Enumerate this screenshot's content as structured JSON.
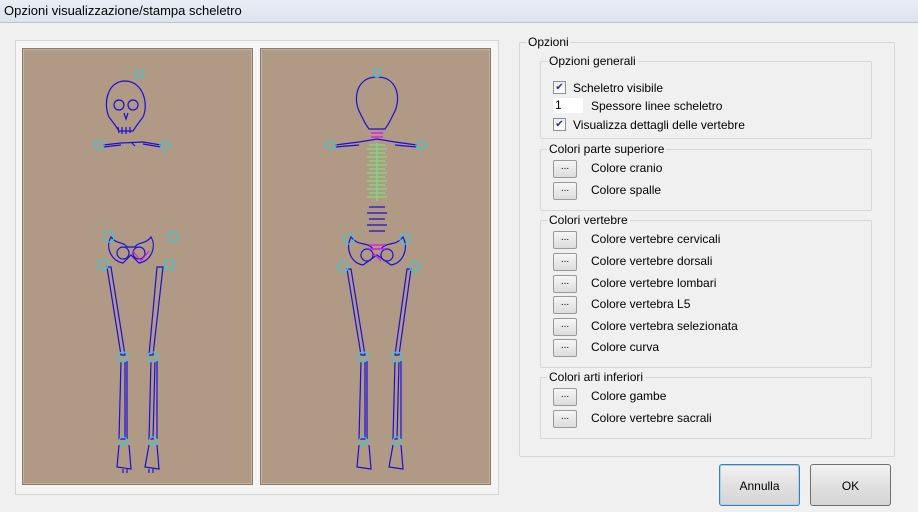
{
  "window": {
    "title": "Opzioni visualizzazione/stampa scheletro"
  },
  "options": {
    "title": "Opzioni",
    "general": {
      "title": "Opzioni generali",
      "skeleton_visible": {
        "label": "Scheletro visibile",
        "checked": true
      },
      "line_thickness": {
        "value": "1",
        "label": "Spessore linee scheletro"
      },
      "vertebra_details": {
        "label": "Visualizza dettagli delle vertebre",
        "checked": true
      }
    },
    "upper": {
      "title": "Colori parte superiore",
      "items": [
        "Colore cranio",
        "Colore spalle"
      ]
    },
    "vertebrae": {
      "title": "Colori vertebre",
      "items": [
        "Colore vertebre cervicali",
        "Colore vertebre dorsali",
        "Colore vertebre lombari",
        "Colore vertebra L5",
        "Colore vertebra selezionata",
        "Colore curva"
      ]
    },
    "lower": {
      "title": "Colori arti inferiori",
      "items": [
        "Colore gambe",
        "Colore vertebre sacrali"
      ]
    },
    "color_button_label": "..."
  },
  "buttons": {
    "cancel": "Annulla",
    "ok": "OK"
  },
  "colors": {
    "pane_background": "#b09a86",
    "bone": "#1a0fd6",
    "joint": "#38c8d8",
    "pelvis_accent": "#e020e0",
    "dorsal_vertebrae": "#7ce07c"
  }
}
